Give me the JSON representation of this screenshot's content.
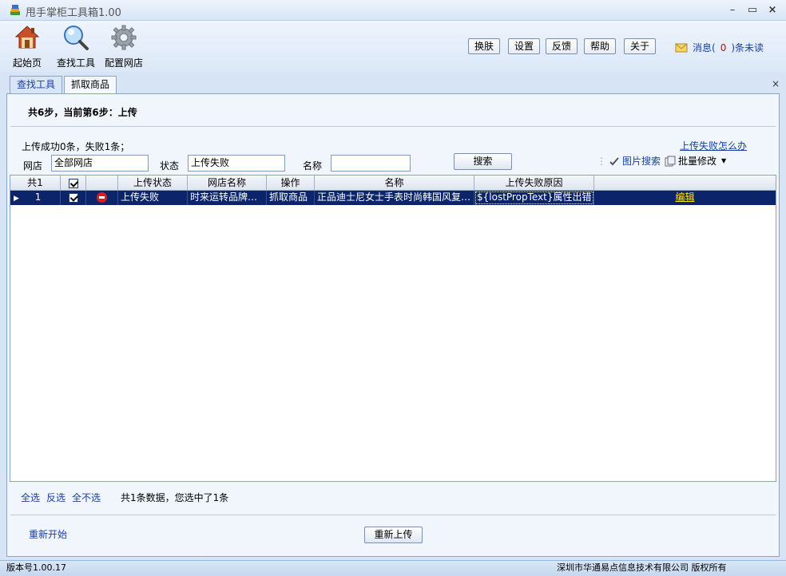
{
  "window": {
    "title": "甩手掌柜工具箱1.00",
    "minimize": "–",
    "maximize": "▭",
    "close": "×"
  },
  "toolbar": {
    "tools": [
      {
        "label": "起始页",
        "icon": "home-icon"
      },
      {
        "label": "查找工具",
        "icon": "magnifier-icon"
      },
      {
        "label": "配置网店",
        "icon": "gear-icon"
      }
    ],
    "buttons": [
      "换肤",
      "设置",
      "反馈",
      "帮助",
      "关于"
    ],
    "message": {
      "prefix": "消息(",
      "count": "0",
      "suffix": ")条未读"
    }
  },
  "tabs": [
    {
      "label": "查找工具",
      "active": false
    },
    {
      "label": "抓取商品",
      "active": true
    }
  ],
  "tab_close": "×",
  "panel": {
    "step_text": "共6步，当前第6步：上传",
    "summary": "上传成功0条，失败1条；",
    "help_link": "上传失败怎么办",
    "filters": {
      "shop_label": "网店",
      "shop_value": "全部网店",
      "status_label": "状态",
      "status_value": "上传失败",
      "name_label": "名称",
      "name_value": ""
    },
    "search_button": "搜索",
    "image_search": "图片搜索",
    "batch_edit": "批量修改"
  },
  "grid": {
    "headers": [
      "共1",
      "",
      "",
      "上传状态",
      "网店名称",
      "操作",
      "名称",
      "上传失败原因",
      ""
    ],
    "rows": [
      {
        "index": "1",
        "checked": true,
        "status": "上传失败",
        "shop": "时来运转品牌…",
        "operation": "抓取商品",
        "name": "正品迪士尼女士手表时尚韩国风复…",
        "reason": "${lostPropText}属性出错",
        "action": "编辑"
      }
    ]
  },
  "bottom": {
    "select_all": "全选",
    "invert": "反选",
    "select_none": "全不选",
    "selection_info": "共1条数据，您选中了1条",
    "restart": "重新开始",
    "reupload": "重新上传"
  },
  "status_bar": {
    "version": "版本号1.00.17",
    "copyright": "深圳市华通易点信息技术有限公司 版权所有"
  },
  "colors": {
    "selected_row": "#0b246a",
    "link": "#1a3f9c",
    "edit_link": "#ffe600",
    "message_count": "#d40000"
  }
}
